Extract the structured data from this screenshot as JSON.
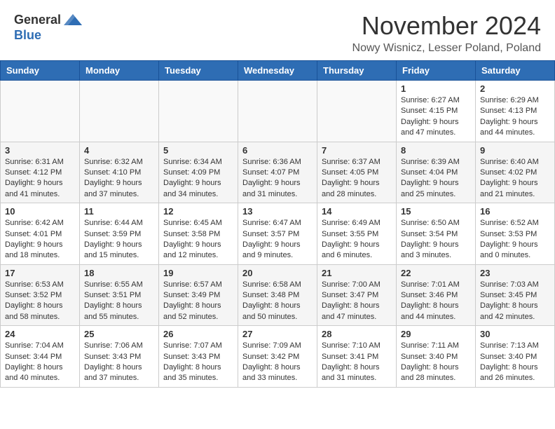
{
  "header": {
    "logo_general": "General",
    "logo_blue": "Blue",
    "title": "November 2024",
    "location": "Nowy Wisnicz, Lesser Poland, Poland"
  },
  "days_of_week": [
    "Sunday",
    "Monday",
    "Tuesday",
    "Wednesday",
    "Thursday",
    "Friday",
    "Saturday"
  ],
  "weeks": [
    [
      {
        "day": "",
        "info": ""
      },
      {
        "day": "",
        "info": ""
      },
      {
        "day": "",
        "info": ""
      },
      {
        "day": "",
        "info": ""
      },
      {
        "day": "",
        "info": ""
      },
      {
        "day": "1",
        "info": "Sunrise: 6:27 AM\nSunset: 4:15 PM\nDaylight: 9 hours and 47 minutes."
      },
      {
        "day": "2",
        "info": "Sunrise: 6:29 AM\nSunset: 4:13 PM\nDaylight: 9 hours and 44 minutes."
      }
    ],
    [
      {
        "day": "3",
        "info": "Sunrise: 6:31 AM\nSunset: 4:12 PM\nDaylight: 9 hours and 41 minutes."
      },
      {
        "day": "4",
        "info": "Sunrise: 6:32 AM\nSunset: 4:10 PM\nDaylight: 9 hours and 37 minutes."
      },
      {
        "day": "5",
        "info": "Sunrise: 6:34 AM\nSunset: 4:09 PM\nDaylight: 9 hours and 34 minutes."
      },
      {
        "day": "6",
        "info": "Sunrise: 6:36 AM\nSunset: 4:07 PM\nDaylight: 9 hours and 31 minutes."
      },
      {
        "day": "7",
        "info": "Sunrise: 6:37 AM\nSunset: 4:05 PM\nDaylight: 9 hours and 28 minutes."
      },
      {
        "day": "8",
        "info": "Sunrise: 6:39 AM\nSunset: 4:04 PM\nDaylight: 9 hours and 25 minutes."
      },
      {
        "day": "9",
        "info": "Sunrise: 6:40 AM\nSunset: 4:02 PM\nDaylight: 9 hours and 21 minutes."
      }
    ],
    [
      {
        "day": "10",
        "info": "Sunrise: 6:42 AM\nSunset: 4:01 PM\nDaylight: 9 hours and 18 minutes."
      },
      {
        "day": "11",
        "info": "Sunrise: 6:44 AM\nSunset: 3:59 PM\nDaylight: 9 hours and 15 minutes."
      },
      {
        "day": "12",
        "info": "Sunrise: 6:45 AM\nSunset: 3:58 PM\nDaylight: 9 hours and 12 minutes."
      },
      {
        "day": "13",
        "info": "Sunrise: 6:47 AM\nSunset: 3:57 PM\nDaylight: 9 hours and 9 minutes."
      },
      {
        "day": "14",
        "info": "Sunrise: 6:49 AM\nSunset: 3:55 PM\nDaylight: 9 hours and 6 minutes."
      },
      {
        "day": "15",
        "info": "Sunrise: 6:50 AM\nSunset: 3:54 PM\nDaylight: 9 hours and 3 minutes."
      },
      {
        "day": "16",
        "info": "Sunrise: 6:52 AM\nSunset: 3:53 PM\nDaylight: 9 hours and 0 minutes."
      }
    ],
    [
      {
        "day": "17",
        "info": "Sunrise: 6:53 AM\nSunset: 3:52 PM\nDaylight: 8 hours and 58 minutes."
      },
      {
        "day": "18",
        "info": "Sunrise: 6:55 AM\nSunset: 3:51 PM\nDaylight: 8 hours and 55 minutes."
      },
      {
        "day": "19",
        "info": "Sunrise: 6:57 AM\nSunset: 3:49 PM\nDaylight: 8 hours and 52 minutes."
      },
      {
        "day": "20",
        "info": "Sunrise: 6:58 AM\nSunset: 3:48 PM\nDaylight: 8 hours and 50 minutes."
      },
      {
        "day": "21",
        "info": "Sunrise: 7:00 AM\nSunset: 3:47 PM\nDaylight: 8 hours and 47 minutes."
      },
      {
        "day": "22",
        "info": "Sunrise: 7:01 AM\nSunset: 3:46 PM\nDaylight: 8 hours and 44 minutes."
      },
      {
        "day": "23",
        "info": "Sunrise: 7:03 AM\nSunset: 3:45 PM\nDaylight: 8 hours and 42 minutes."
      }
    ],
    [
      {
        "day": "24",
        "info": "Sunrise: 7:04 AM\nSunset: 3:44 PM\nDaylight: 8 hours and 40 minutes."
      },
      {
        "day": "25",
        "info": "Sunrise: 7:06 AM\nSunset: 3:43 PM\nDaylight: 8 hours and 37 minutes."
      },
      {
        "day": "26",
        "info": "Sunrise: 7:07 AM\nSunset: 3:43 PM\nDaylight: 8 hours and 35 minutes."
      },
      {
        "day": "27",
        "info": "Sunrise: 7:09 AM\nSunset: 3:42 PM\nDaylight: 8 hours and 33 minutes."
      },
      {
        "day": "28",
        "info": "Sunrise: 7:10 AM\nSunset: 3:41 PM\nDaylight: 8 hours and 31 minutes."
      },
      {
        "day": "29",
        "info": "Sunrise: 7:11 AM\nSunset: 3:40 PM\nDaylight: 8 hours and 28 minutes."
      },
      {
        "day": "30",
        "info": "Sunrise: 7:13 AM\nSunset: 3:40 PM\nDaylight: 8 hours and 26 minutes."
      }
    ]
  ]
}
